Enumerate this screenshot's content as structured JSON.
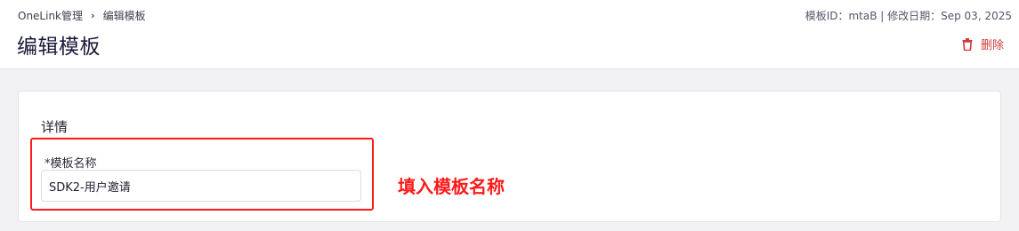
{
  "breadcrumb": {
    "parent": "OneLink管理",
    "separator": "›",
    "current": "编辑模板"
  },
  "header": {
    "title": "编辑模板",
    "meta": "模板ID：mtaB | 修改日期：Sep 03, 2025",
    "delete_label": "删除"
  },
  "details": {
    "section_title": "详情",
    "name_label": "*模板名称",
    "name_value": "SDK2-用户邀请"
  },
  "annotation": {
    "text": "填入模板名称"
  },
  "colors": {
    "accent_red": "#ff1a1a",
    "delete_red": "#d23b3b",
    "title": "#1b1b3a"
  },
  "icons": {
    "delete": "trash-icon",
    "breadcrumb_separator": "chevron-right-icon"
  }
}
